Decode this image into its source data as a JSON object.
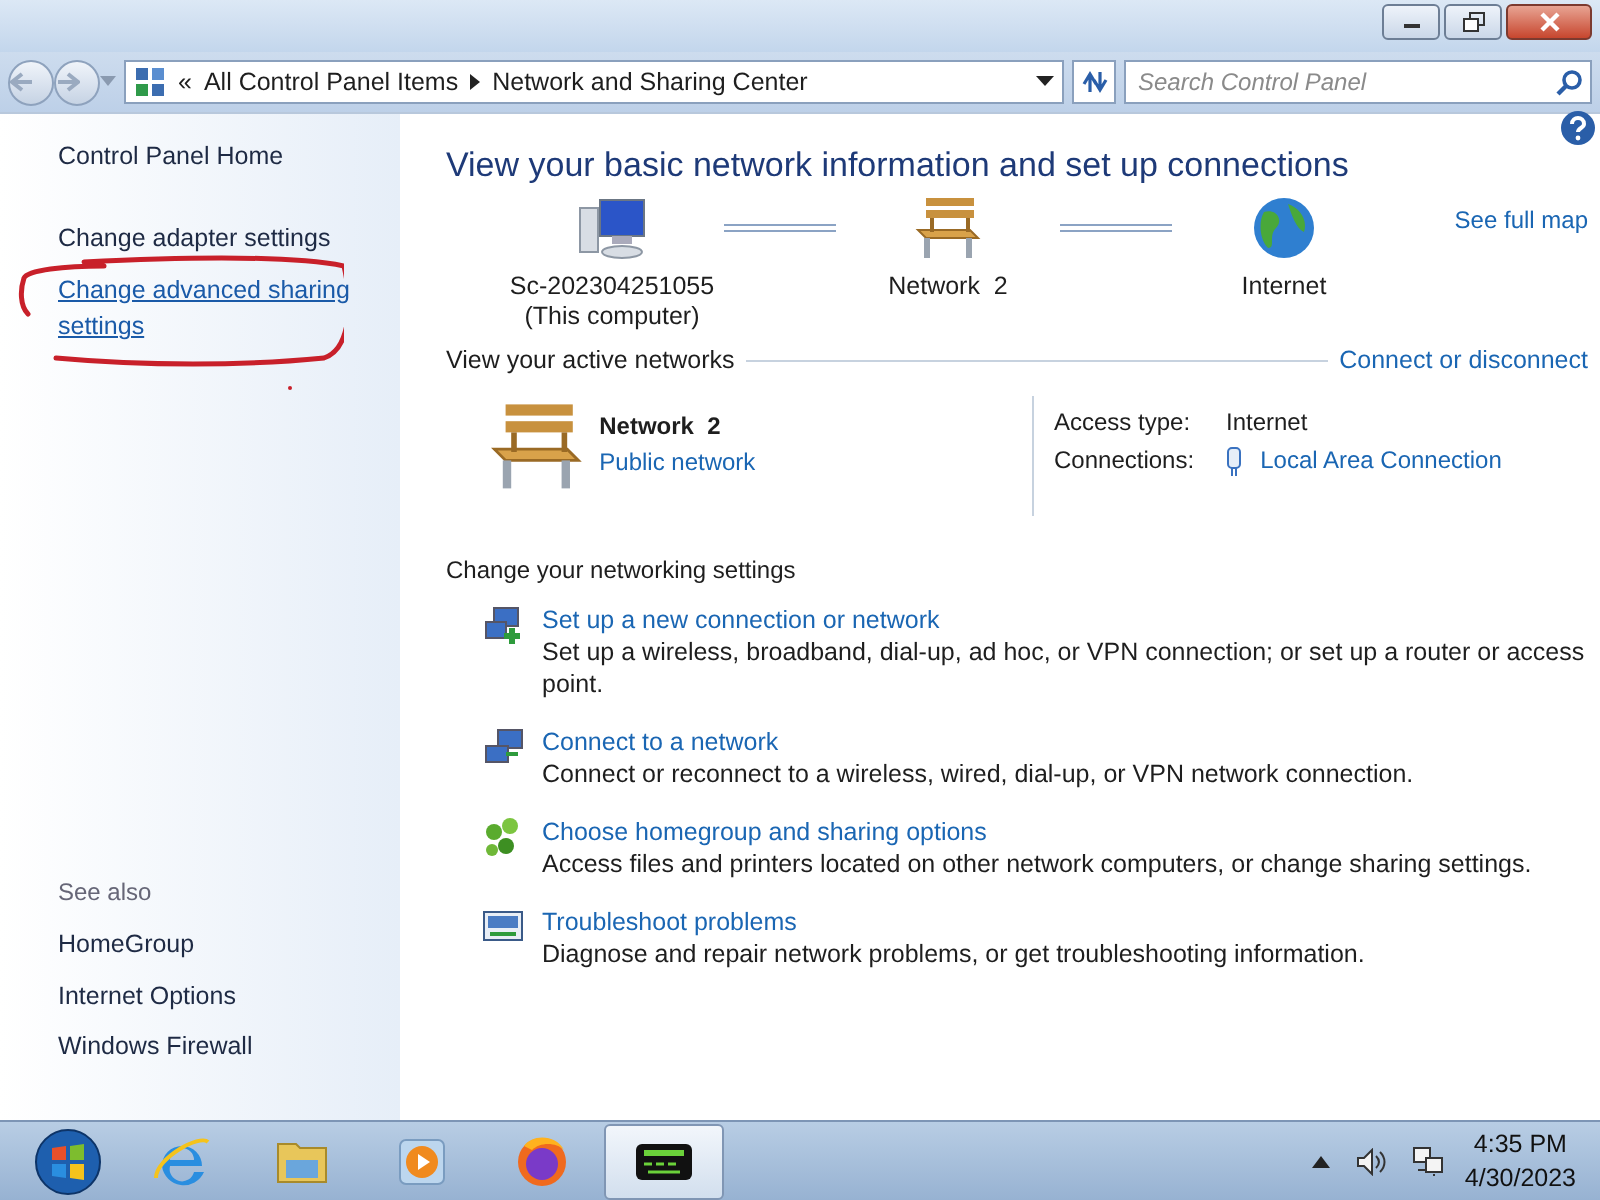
{
  "address_bar": {
    "overflow": "«",
    "path": [
      "All Control Panel Items",
      "Network and Sharing Center"
    ]
  },
  "search": {
    "placeholder": "Search Control Panel"
  },
  "sidebar": {
    "links": [
      {
        "label": "Control Panel Home",
        "hovered": false
      },
      {
        "label": "Change adapter settings",
        "hovered": false
      },
      {
        "label": "Change advanced sharing settings",
        "hovered": true
      }
    ],
    "see_also_heading": "See also",
    "see_also": [
      {
        "label": "HomeGroup"
      },
      {
        "label": "Internet Options"
      },
      {
        "label": "Windows Firewall"
      }
    ]
  },
  "main": {
    "heading": "View your basic network information and set up connections",
    "see_full_map": "See full map",
    "map_nodes": [
      {
        "kind": "computer",
        "label": "Sc-202304251055",
        "sublabel": "(This computer)"
      },
      {
        "kind": "network",
        "label": "Network  2"
      },
      {
        "kind": "internet",
        "label": "Internet"
      }
    ],
    "active_networks": {
      "heading": "View your active networks",
      "action": "Connect or disconnect",
      "network": {
        "name": "Network  2",
        "type": "Public network"
      },
      "details": [
        {
          "label": "Access type:",
          "value": "Internet",
          "kind": "text"
        },
        {
          "label": "Connections:",
          "value": "Local Area Connection",
          "kind": "link"
        }
      ]
    },
    "settings": {
      "heading": "Change your networking settings",
      "tasks": [
        {
          "kind": "new-connection",
          "title": "Set up a new connection or network",
          "description": "Set up a wireless, broadband, dial-up, ad hoc, or VPN connection; or set up a router or access point."
        },
        {
          "kind": "connect",
          "title": "Connect to a network",
          "description": "Connect or reconnect to a wireless, wired, dial-up, or VPN network connection."
        },
        {
          "kind": "homegroup",
          "title": "Choose homegroup and sharing options",
          "description": "Access files and printers located on other network computers, or change sharing settings."
        },
        {
          "kind": "troubleshoot",
          "title": "Troubleshoot problems",
          "description": "Diagnose and repair network problems, or get troubleshooting information."
        }
      ]
    }
  },
  "annotations": [
    {
      "kind": "freehand-circle"
    }
  ],
  "taskbar": {
    "apps": [
      {
        "kind": "browser",
        "active": false
      },
      {
        "kind": "folder",
        "active": false
      },
      {
        "kind": "media",
        "active": false
      },
      {
        "kind": "firefox",
        "active": false
      },
      {
        "kind": "terminal",
        "active": true
      }
    ],
    "clock": {
      "time": "4:35 PM",
      "date": "4/30/2023"
    }
  }
}
